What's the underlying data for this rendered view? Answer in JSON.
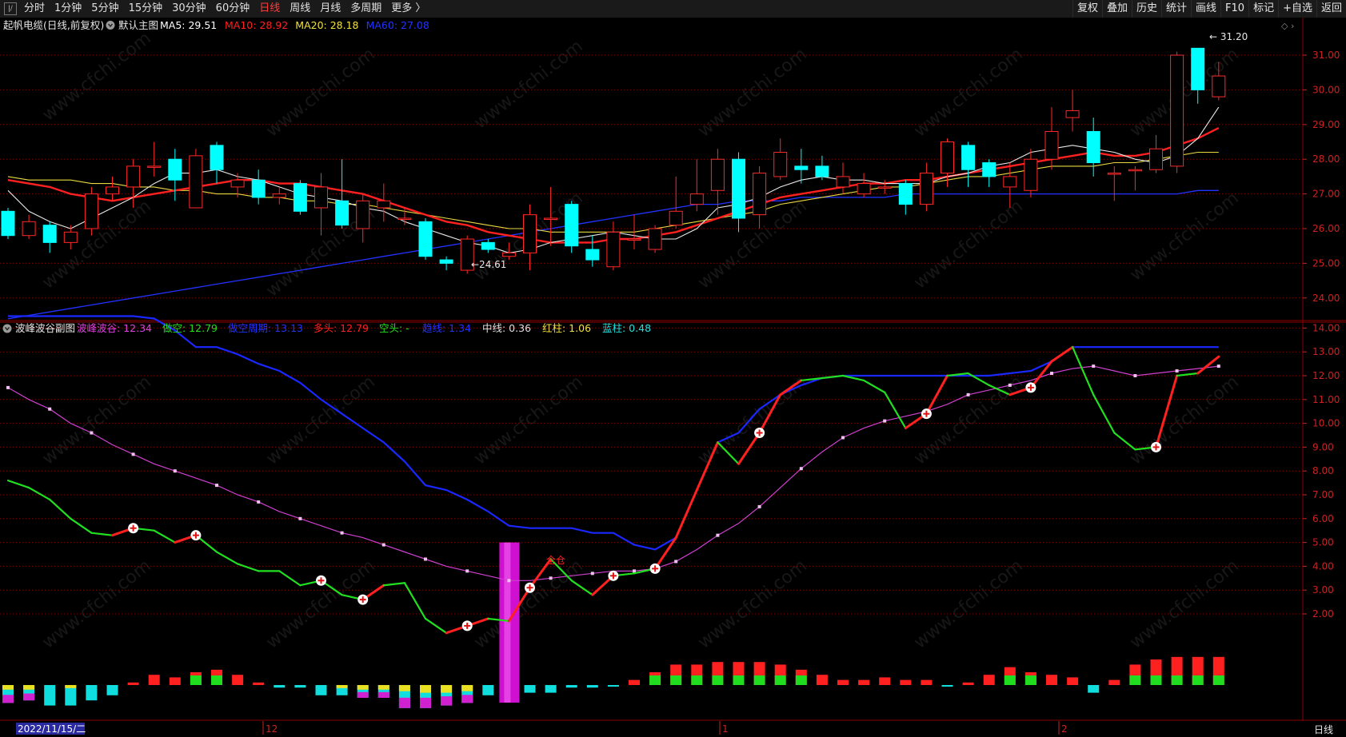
{
  "toolbar": {
    "periods": [
      {
        "label": "分时",
        "active": false
      },
      {
        "label": "1分钟",
        "active": false
      },
      {
        "label": "5分钟",
        "active": false
      },
      {
        "label": "15分钟",
        "active": false
      },
      {
        "label": "30分钟",
        "active": false
      },
      {
        "label": "60分钟",
        "active": false
      },
      {
        "label": "日线",
        "active": true
      },
      {
        "label": "周线",
        "active": false
      },
      {
        "label": "月线",
        "active": false
      },
      {
        "label": "多周期",
        "active": false
      },
      {
        "label": "更多 〉",
        "active": false
      }
    ],
    "right_tools": [
      "复权",
      "叠加",
      "历史",
      "统计",
      "画线",
      "F10",
      "标记",
      "+自选",
      "返回"
    ]
  },
  "main_panel": {
    "title": "起帆电缆(日线,前复权)",
    "indicator_name": "默认主图",
    "ma_legend": [
      {
        "text": "MA5: 29.51",
        "color": "#ffffff"
      },
      {
        "text": "MA10: 28.92",
        "color": "#ff2020"
      },
      {
        "text": "MA20: 28.18",
        "color": "#f0e040"
      },
      {
        "text": "MA60: 27.08",
        "color": "#2233ff"
      }
    ],
    "high_label": "31.20",
    "low_label": "24.61",
    "y_ticks": [
      "31.00",
      "30.00",
      "29.00",
      "28.00",
      "27.00",
      "26.00",
      "25.00",
      "24.00"
    ]
  },
  "sub_panel": {
    "indicator_name": "波峰波谷副图",
    "legend": [
      {
        "text": "波峰波谷: 12.34",
        "color": "#e040e0"
      },
      {
        "text": "做空: 12.79",
        "color": "#20e020"
      },
      {
        "text": "做空周期: 13.13",
        "color": "#2233ff"
      },
      {
        "text": "多头: 12.79",
        "color": "#ff2020"
      },
      {
        "text": "空头: -",
        "color": "#20e020"
      },
      {
        "text": "趋线: 1.34",
        "color": "#2233ff"
      },
      {
        "text": "中线: 0.36",
        "color": "#e0e0e0"
      },
      {
        "text": "红柱: 1.06",
        "color": "#f0e040"
      },
      {
        "text": "蓝柱: 0.48",
        "color": "#20e0e0"
      }
    ],
    "signal_label": "全仓",
    "y_ticks": [
      "14.00",
      "13.00",
      "12.00",
      "11.00",
      "10.00",
      "9.00",
      "8.00",
      "7.00",
      "6.00",
      "5.00",
      "4.00",
      "3.00",
      "2.00"
    ]
  },
  "bottom_axis": {
    "date_label": "2022/11/15/二",
    "month_labels": [
      "12",
      "1",
      "2"
    ],
    "period_label": "日线"
  },
  "watermark": "www.cfchi.com",
  "colors": {
    "up": "#ff2828",
    "down": "#00ffff",
    "grid": "#8b0000",
    "axis": "#cc2222"
  },
  "chart_data": {
    "type": "candlestick",
    "candles": [
      [
        26.5,
        25.8,
        26.6,
        25.7
      ],
      [
        25.8,
        26.2,
        26.4,
        25.7
      ],
      [
        26.1,
        25.6,
        26.2,
        25.3
      ],
      [
        25.6,
        25.9,
        26.1,
        25.4
      ],
      [
        26.0,
        27.0,
        27.2,
        25.8
      ],
      [
        27.0,
        27.2,
        27.5,
        26.8
      ],
      [
        27.2,
        27.8,
        28.0,
        26.6
      ],
      [
        27.8,
        27.8,
        28.5,
        27.5
      ],
      [
        28.0,
        27.4,
        28.3,
        26.8
      ],
      [
        26.6,
        28.1,
        28.3,
        26.6
      ],
      [
        28.4,
        27.7,
        28.5,
        27.3
      ],
      [
        27.2,
        27.4,
        27.6,
        26.9
      ],
      [
        27.4,
        26.9,
        27.7,
        26.7
      ],
      [
        26.9,
        27.0,
        27.2,
        26.7
      ],
      [
        27.3,
        26.5,
        27.4,
        26.4
      ],
      [
        26.6,
        27.2,
        27.6,
        25.8
      ],
      [
        26.8,
        26.1,
        28.0,
        26.0
      ],
      [
        26.0,
        26.8,
        27.0,
        25.6
      ],
      [
        26.6,
        26.8,
        27.3,
        26.2
      ],
      [
        26.3,
        26.3,
        26.6,
        26.1
      ],
      [
        26.2,
        25.2,
        26.3,
        25.1
      ],
      [
        25.1,
        25.0,
        25.2,
        24.8
      ],
      [
        24.8,
        25.7,
        25.8,
        24.7
      ],
      [
        25.6,
        25.4,
        25.7,
        25.3
      ],
      [
        25.2,
        25.3,
        25.6,
        25.1
      ],
      [
        25.3,
        26.4,
        26.7,
        24.8
      ],
      [
        26.3,
        26.3,
        27.2,
        25.5
      ],
      [
        26.7,
        25.5,
        26.8,
        25.3
      ],
      [
        25.4,
        25.1,
        25.8,
        24.9
      ],
      [
        24.9,
        25.9,
        26.2,
        24.8
      ],
      [
        25.7,
        25.7,
        26.4,
        25.4
      ],
      [
        25.4,
        26.0,
        26.1,
        25.3
      ],
      [
        26.1,
        26.5,
        27.5,
        26.0
      ],
      [
        26.7,
        27.0,
        28.0,
        26.5
      ],
      [
        27.1,
        28.0,
        28.3,
        26.4
      ],
      [
        28.0,
        26.3,
        28.2,
        25.9
      ],
      [
        26.4,
        27.6,
        27.8,
        26.0
      ],
      [
        27.5,
        28.2,
        28.6,
        27.4
      ],
      [
        27.8,
        27.7,
        28.3,
        27.3
      ],
      [
        27.8,
        27.5,
        28.1,
        27.4
      ],
      [
        27.2,
        27.5,
        27.9,
        27.0
      ],
      [
        27.0,
        27.3,
        27.6,
        26.9
      ],
      [
        27.2,
        27.2,
        27.4,
        27.0
      ],
      [
        27.3,
        26.7,
        27.4,
        26.4
      ],
      [
        26.7,
        27.6,
        27.9,
        26.5
      ],
      [
        27.6,
        28.5,
        28.6,
        27.2
      ],
      [
        28.4,
        27.7,
        28.5,
        27.2
      ],
      [
        27.9,
        27.5,
        28.0,
        27.2
      ],
      [
        27.2,
        27.5,
        27.9,
        26.6
      ],
      [
        27.1,
        28.0,
        28.3,
        26.9
      ],
      [
        28.0,
        28.8,
        29.5,
        27.7
      ],
      [
        29.2,
        29.4,
        30.0,
        28.8
      ],
      [
        28.8,
        27.9,
        29.2,
        27.5
      ],
      [
        27.6,
        27.6,
        27.8,
        26.8
      ],
      [
        27.7,
        27.7,
        27.8,
        27.1
      ],
      [
        27.7,
        28.3,
        28.7,
        27.6
      ],
      [
        27.8,
        31.0,
        31.1,
        27.6
      ],
      [
        31.2,
        30.0,
        31.2,
        29.6
      ],
      [
        29.8,
        30.4,
        30.8,
        29.7
      ]
    ],
    "ma5": [
      27.1,
      26.5,
      26.2,
      26.0,
      26.3,
      26.6,
      26.9,
      27.3,
      27.6,
      27.6,
      27.7,
      27.5,
      27.4,
      27.2,
      27.0,
      26.9,
      26.8,
      26.6,
      26.5,
      26.2,
      26.0,
      25.8,
      25.6,
      25.5,
      25.3,
      25.4,
      25.6,
      25.7,
      25.8,
      25.9,
      25.8,
      25.7,
      25.7,
      26.0,
      26.6,
      26.7,
      26.9,
      27.2,
      27.4,
      27.5,
      27.4,
      27.4,
      27.3,
      27.3,
      27.3,
      27.5,
      27.6,
      27.8,
      27.9,
      28.2,
      28.3,
      28.4,
      28.3,
      28.2,
      28.0,
      27.9,
      28.1,
      28.6,
      29.5
    ],
    "ma10": [
      27.4,
      27.3,
      27.2,
      27.0,
      26.9,
      26.8,
      26.9,
      27.0,
      27.1,
      27.2,
      27.3,
      27.4,
      27.4,
      27.3,
      27.3,
      27.2,
      27.1,
      27.0,
      26.8,
      26.6,
      26.4,
      26.2,
      26.1,
      25.9,
      25.8,
      25.7,
      25.6,
      25.6,
      25.6,
      25.7,
      25.7,
      25.8,
      25.9,
      26.1,
      26.3,
      26.5,
      26.7,
      26.9,
      27.0,
      27.1,
      27.2,
      27.3,
      27.3,
      27.4,
      27.4,
      27.5,
      27.6,
      27.7,
      27.8,
      27.9,
      28.0,
      28.1,
      28.2,
      28.1,
      28.1,
      28.2,
      28.4,
      28.6,
      28.9
    ],
    "ma20": [
      27.5,
      27.4,
      27.4,
      27.4,
      27.3,
      27.3,
      27.2,
      27.2,
      27.1,
      27.1,
      27.0,
      27.0,
      26.9,
      26.9,
      26.8,
      26.8,
      26.7,
      26.7,
      26.6,
      26.5,
      26.4,
      26.3,
      26.2,
      26.1,
      26.0,
      26.0,
      25.9,
      25.9,
      25.9,
      25.9,
      25.9,
      26.0,
      26.1,
      26.2,
      26.3,
      26.4,
      26.5,
      26.7,
      26.8,
      26.9,
      27.0,
      27.1,
      27.2,
      27.2,
      27.3,
      27.4,
      27.5,
      27.5,
      27.6,
      27.7,
      27.8,
      27.8,
      27.8,
      27.9,
      27.9,
      28.0,
      28.1,
      28.2,
      28.2
    ],
    "ma60": [
      23.4,
      23.5,
      23.6,
      23.7,
      23.8,
      23.9,
      24.0,
      24.1,
      24.2,
      24.3,
      24.4,
      24.5,
      24.6,
      24.7,
      24.8,
      24.9,
      25.0,
      25.1,
      25.2,
      25.3,
      25.4,
      25.5,
      25.6,
      25.7,
      25.8,
      25.9,
      26.0,
      26.1,
      26.2,
      26.3,
      26.4,
      26.5,
      26.6,
      26.7,
      26.7,
      26.8,
      26.8,
      26.8,
      26.9,
      26.9,
      26.9,
      26.9,
      26.9,
      27.0,
      27.0,
      27.0,
      27.0,
      27.0,
      27.0,
      27.0,
      27.0,
      27.0,
      27.0,
      27.0,
      27.0,
      27.0,
      27.0,
      27.1,
      27.1
    ],
    "osc": [
      7.6,
      7.3,
      6.8,
      6.0,
      5.4,
      5.3,
      5.6,
      5.5,
      5.0,
      5.3,
      4.6,
      4.1,
      3.8,
      3.8,
      3.2,
      3.4,
      2.8,
      2.6,
      3.2,
      3.3,
      1.8,
      1.2,
      1.5,
      1.8,
      1.7,
      3.1,
      4.3,
      3.4,
      2.8,
      3.6,
      3.7,
      3.9,
      5.2,
      7.2,
      9.2,
      8.3,
      9.6,
      11.2,
      11.8,
      11.9,
      12.0,
      11.8,
      11.3,
      9.8,
      10.4,
      12.0,
      12.1,
      11.6,
      11.2,
      11.5,
      12.6,
      13.2,
      11.2,
      9.6,
      8.9,
      9.0,
      12.0,
      12.1,
      12.8
    ],
    "slow": [
      11.5,
      11.0,
      10.6,
      10.0,
      9.6,
      9.1,
      8.7,
      8.3,
      8.0,
      7.7,
      7.4,
      7.0,
      6.7,
      6.3,
      6.0,
      5.7,
      5.4,
      5.2,
      4.9,
      4.6,
      4.3,
      4.0,
      3.8,
      3.6,
      3.4,
      3.4,
      3.5,
      3.6,
      3.7,
      3.8,
      3.8,
      3.9,
      4.2,
      4.7,
      5.3,
      5.8,
      6.5,
      7.3,
      8.1,
      8.8,
      9.4,
      9.8,
      10.1,
      10.3,
      10.5,
      10.8,
      11.2,
      11.4,
      11.6,
      11.8,
      12.1,
      12.3,
      12.4,
      12.2,
      12.0,
      12.1,
      12.2,
      12.3,
      12.4
    ],
    "env": [
      14.5,
      14.5,
      14.5,
      14.5,
      14.5,
      14.5,
      14.5,
      14.4,
      13.9,
      13.2,
      13.2,
      12.9,
      12.5,
      12.2,
      11.7,
      11.0,
      10.4,
      9.8,
      9.2,
      8.4,
      7.4,
      7.2,
      6.8,
      6.3,
      5.7,
      5.6,
      5.6,
      5.6,
      5.4,
      5.4,
      4.9,
      4.7,
      5.2,
      7.2,
      9.2,
      9.6,
      10.6,
      11.2,
      11.6,
      11.9,
      12.0,
      12.0,
      12.0,
      12.0,
      12.0,
      12.0,
      12.0,
      12.0,
      12.1,
      12.2,
      12.6,
      13.2,
      13.2,
      13.2,
      13.2,
      13.2,
      13.2,
      13.2,
      13.2
    ],
    "bars": [
      [
        -0.7,
        0.3
      ],
      [
        -0.6,
        0.3
      ],
      [
        -0.8,
        0
      ],
      [
        -0.8,
        0.2
      ],
      [
        -0.6,
        0
      ],
      [
        -0.4,
        0
      ],
      [
        0.1,
        0
      ],
      [
        0.4,
        0
      ],
      [
        0.3,
        0
      ],
      [
        0.5,
        0
      ],
      [
        0.6,
        0
      ],
      [
        0.4,
        0
      ],
      [
        0.1,
        0
      ],
      [
        -0.1,
        0
      ],
      [
        -0.1,
        0
      ],
      [
        -0.4,
        0
      ],
      [
        -0.4,
        0.2
      ],
      [
        -0.5,
        0.3
      ],
      [
        -0.5,
        0.3
      ],
      [
        -0.9,
        0.4
      ],
      [
        -0.9,
        0.5
      ],
      [
        -0.8,
        0.5
      ],
      [
        -0.7,
        0.4
      ],
      [
        -0.4,
        0
      ],
      [
        5.0,
        0
      ],
      [
        -0.3,
        0
      ],
      [
        -0.3,
        0
      ],
      [
        -0.1,
        0
      ],
      [
        -0.1,
        0
      ],
      [
        -0.05,
        0
      ],
      [
        0.2,
        0
      ],
      [
        0.5,
        0
      ],
      [
        0.8,
        0
      ],
      [
        0.8,
        0
      ],
      [
        0.9,
        0
      ],
      [
        0.9,
        0
      ],
      [
        0.9,
        0
      ],
      [
        0.8,
        0
      ],
      [
        0.6,
        0
      ],
      [
        0.4,
        0
      ],
      [
        0.2,
        0
      ],
      [
        0.2,
        0
      ],
      [
        0.3,
        0
      ],
      [
        0.2,
        0
      ],
      [
        0.2,
        0
      ],
      [
        -0.05,
        0
      ],
      [
        0.1,
        0
      ],
      [
        0.4,
        0
      ],
      [
        0.7,
        0
      ],
      [
        0.5,
        0
      ],
      [
        0.4,
        0
      ],
      [
        0.3,
        0
      ],
      [
        -0.3,
        0
      ],
      [
        0.2,
        0
      ],
      [
        0.8,
        0
      ],
      [
        1.0,
        0
      ],
      [
        1.1,
        0
      ],
      [
        1.1,
        0
      ],
      [
        1.1,
        0
      ]
    ],
    "buy_signal_indices": [
      6,
      9,
      15,
      17,
      22,
      25,
      29,
      31,
      36,
      44,
      49,
      55
    ]
  }
}
